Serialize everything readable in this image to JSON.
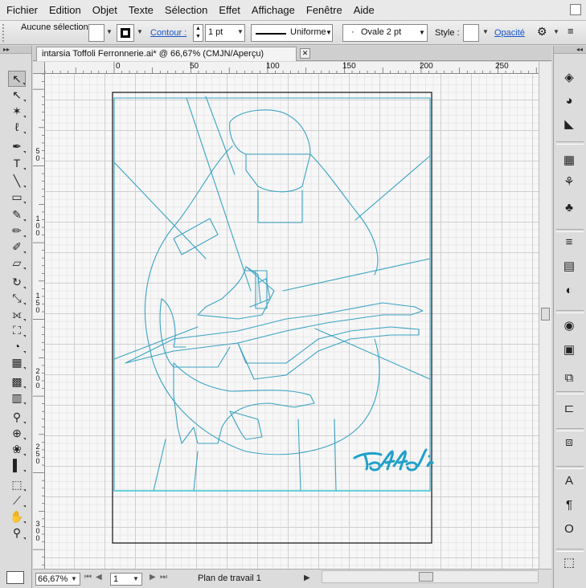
{
  "menu": {
    "items": [
      "Fichier",
      "Edition",
      "Objet",
      "Texte",
      "Sélection",
      "Effet",
      "Affichage",
      "Fenêtre",
      "Aide"
    ]
  },
  "control_bar": {
    "selection_label": "Aucune sélection",
    "contour_label": "Contour :",
    "stroke_weight": "1 pt",
    "stroke_profile": "Uniforme",
    "brush": "Ovale 2 pt",
    "style_label": "Style :",
    "opacity_label": "Opacité"
  },
  "document": {
    "tab_title": "intarsia Toffoli Ferronnerie.ai* @ 66,67% (CMJN/Aperçu)",
    "close_glyph": "✕",
    "signature": "Toffoli",
    "stroke_color": "#3aa3c2"
  },
  "rulers": {
    "top_labels": [
      "0",
      "50",
      "100",
      "150",
      "200",
      "250"
    ],
    "left_labels": [
      "5\n0",
      "1\n0\n0",
      "1\n5\n0",
      "2\n0\n0",
      "2\n5\n0",
      "3\n0\n0"
    ]
  },
  "status_bar": {
    "zoom": "66,67%",
    "page": "1",
    "status": "Plan de travail 1",
    "nav_first": "⏮",
    "nav_prev": "◀",
    "nav_next": "▶",
    "nav_last": "⏭"
  },
  "toolbar": {
    "tools": [
      {
        "name": "selection-tool-icon",
        "glyph": "↖"
      },
      {
        "name": "direct-selection-tool-icon",
        "glyph": "↖"
      },
      {
        "name": "magic-wand-tool-icon",
        "glyph": "✶"
      },
      {
        "name": "lasso-tool-icon",
        "glyph": "ℓ"
      },
      {
        "name": "pen-tool-icon",
        "glyph": "✒"
      },
      {
        "name": "type-tool-icon",
        "glyph": "T"
      },
      {
        "name": "line-tool-icon",
        "glyph": "╲"
      },
      {
        "name": "rectangle-tool-icon",
        "glyph": "▭"
      },
      {
        "name": "paintbrush-tool-icon",
        "glyph": "✎"
      },
      {
        "name": "pencil-tool-icon",
        "glyph": "✏"
      },
      {
        "name": "blob-brush-tool-icon",
        "glyph": "✐"
      },
      {
        "name": "eraser-tool-icon",
        "glyph": "▱"
      },
      {
        "name": "rotate-tool-icon",
        "glyph": "↻"
      },
      {
        "name": "scale-tool-icon",
        "glyph": "⤡"
      },
      {
        "name": "width-tool-icon",
        "glyph": "⟗"
      },
      {
        "name": "free-transform-tool-icon",
        "glyph": "⛶"
      },
      {
        "name": "shape-builder-tool-icon",
        "glyph": "◔"
      },
      {
        "name": "perspective-grid-tool-icon",
        "glyph": "▦"
      },
      {
        "name": "mesh-tool-icon",
        "glyph": "▩"
      },
      {
        "name": "gradient-tool-icon",
        "glyph": "▥"
      },
      {
        "name": "eyedropper-tool-icon",
        "glyph": "⚲"
      },
      {
        "name": "blend-tool-icon",
        "glyph": "⊕"
      },
      {
        "name": "symbol-sprayer-tool-icon",
        "glyph": "❀"
      },
      {
        "name": "column-graph-tool-icon",
        "glyph": "▌"
      },
      {
        "name": "artboard-tool-icon",
        "glyph": "⬚"
      },
      {
        "name": "slice-tool-icon",
        "glyph": "⟋"
      },
      {
        "name": "hand-tool-icon",
        "glyph": "✋"
      },
      {
        "name": "zoom-tool-icon",
        "glyph": "⚲"
      }
    ]
  },
  "dock": {
    "panels": [
      {
        "name": "layers-panel-icon",
        "glyph": "◈"
      },
      {
        "name": "color-panel-icon",
        "glyph": "◕"
      },
      {
        "name": "color-guide-panel-icon",
        "glyph": "◣"
      },
      {
        "name": "swatches-panel-icon",
        "glyph": "▦"
      },
      {
        "name": "brushes-panel-icon",
        "glyph": "⚘"
      },
      {
        "name": "symbols-panel-icon",
        "glyph": "♣"
      },
      {
        "name": "stroke-panel-icon",
        "glyph": "≡"
      },
      {
        "name": "gradient-panel-icon",
        "glyph": "▤"
      },
      {
        "name": "transparency-panel-icon",
        "glyph": "◐"
      },
      {
        "name": "appearance-panel-icon",
        "glyph": "◉"
      },
      {
        "name": "graphic-styles-panel-icon",
        "glyph": "▣"
      },
      {
        "name": "transform-panel-icon",
        "glyph": "⧉"
      },
      {
        "name": "align-panel-icon",
        "glyph": "⊏"
      },
      {
        "name": "pathfinder-panel-icon",
        "glyph": "⧈"
      },
      {
        "name": "character-panel-icon",
        "glyph": "A"
      },
      {
        "name": "paragraph-panel-icon",
        "glyph": "¶"
      },
      {
        "name": "opentype-panel-icon",
        "glyph": "O"
      },
      {
        "name": "artboards-panel-icon",
        "glyph": "⬚"
      }
    ]
  }
}
